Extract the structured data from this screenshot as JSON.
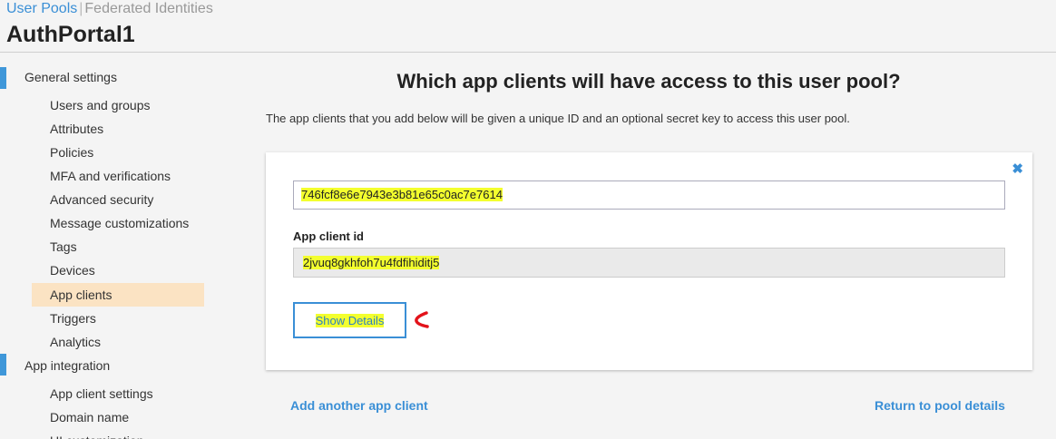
{
  "top_nav": {
    "user_pools": "User Pools",
    "separator": "|",
    "federated": "Federated Identities"
  },
  "page_title": "AuthPortal1",
  "sidebar": {
    "general_settings": "General settings",
    "general_items": [
      "Users and groups",
      "Attributes",
      "Policies",
      "MFA and verifications",
      "Advanced security",
      "Message customizations",
      "Tags",
      "Devices",
      "App clients",
      "Triggers",
      "Analytics"
    ],
    "app_integration": "App integration",
    "integration_items": [
      "App client settings",
      "Domain name",
      "UI customization"
    ],
    "active_item": "App clients"
  },
  "main": {
    "heading": "Which app clients will have access to this user pool?",
    "description": "The app clients that you add below will be given a unique ID and an optional secret key to access this user pool.",
    "client": {
      "name_value": "746fcf8e6e7943e3b81e65c0ac7e7614",
      "id_label": "App client id",
      "id_value": "2jvuq8gkhfoh7u4fdfihiditj5",
      "show_details": "Show Details"
    },
    "add_another": "Add another app client",
    "return_link": "Return to pool details"
  },
  "icons": {
    "close": "close-icon",
    "annotation": "red-arrow-annotation"
  },
  "colors": {
    "link": "#3a8fd6",
    "active_bg": "#fbe3c3",
    "marker": "#3f97d9",
    "highlight": "#f3ff2e",
    "annotation": "#e3131b"
  }
}
